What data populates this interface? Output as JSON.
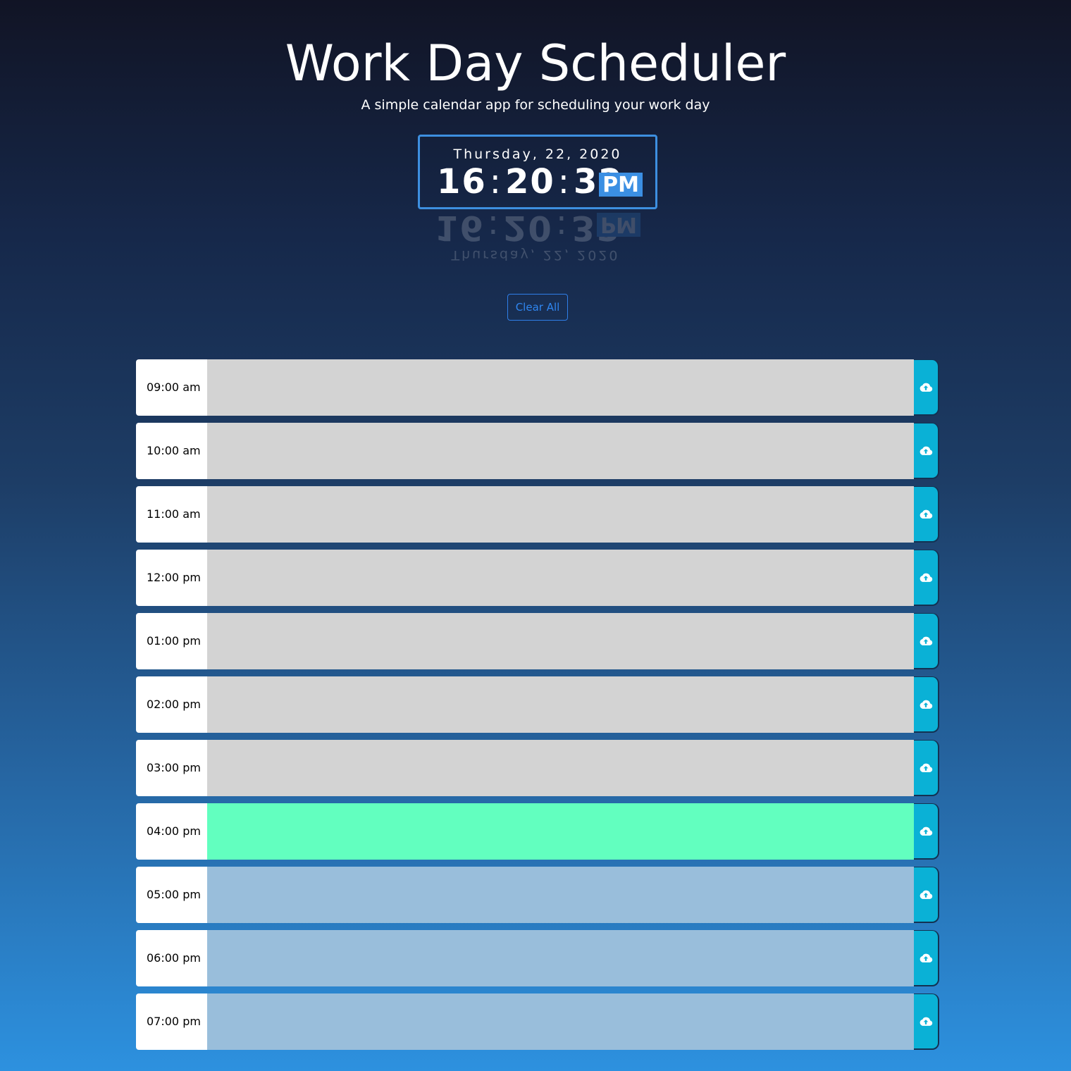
{
  "header": {
    "title": "Work Day Scheduler",
    "subtitle": "A simple calendar app for scheduling your work day"
  },
  "clock": {
    "date": "Thursday, 22, 2020",
    "hours": "16",
    "minutes": "20",
    "seconds": "32",
    "separator": ":",
    "ampm": "PM"
  },
  "clear_button": {
    "label": "Clear All"
  },
  "save_icon": "cloud-upload-icon",
  "colors": {
    "past": "#d3d3d3",
    "present": "#62ffbf",
    "future": "#99bedb",
    "save": "#0ab1d6",
    "accent": "#3b8fe3"
  },
  "time_blocks": [
    {
      "hour": "09:00 am",
      "state": "past",
      "text": ""
    },
    {
      "hour": "10:00 am",
      "state": "past",
      "text": ""
    },
    {
      "hour": "11:00 am",
      "state": "past",
      "text": ""
    },
    {
      "hour": "12:00 pm",
      "state": "past",
      "text": ""
    },
    {
      "hour": "01:00 pm",
      "state": "past",
      "text": ""
    },
    {
      "hour": "02:00 pm",
      "state": "past",
      "text": ""
    },
    {
      "hour": "03:00 pm",
      "state": "past",
      "text": ""
    },
    {
      "hour": "04:00 pm",
      "state": "present",
      "text": ""
    },
    {
      "hour": "05:00 pm",
      "state": "future",
      "text": ""
    },
    {
      "hour": "06:00 pm",
      "state": "future",
      "text": ""
    },
    {
      "hour": "07:00 pm",
      "state": "future",
      "text": ""
    }
  ]
}
